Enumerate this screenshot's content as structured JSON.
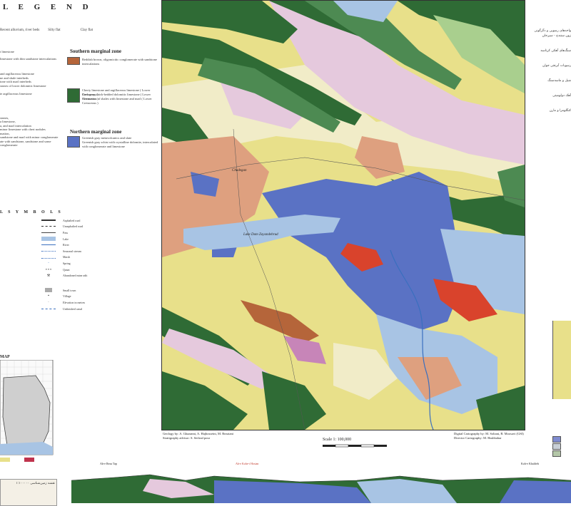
{
  "legend": {
    "title": "L E G E N D",
    "top_items": [
      "Recent alluvium, river beds",
      "Silty flat",
      "Clay flat"
    ],
    "left_fragments": [
      "t limestone",
      "limestone with thin sandstone intercalations",
      "and argillaceous limestone",
      "ne and shale interbeds",
      "tone with marl interbeds",
      "stones of lower dolomitic limestone",
      "te argillaceous limestone",
      "stones,",
      "a limestone,",
      "a, and marl intercalation",
      "minor limestone with chert nodules",
      "mation,",
      "sandstone and marl with minor conglomerate",
      "ate with sandstone, sandstone and some conglomerate"
    ],
    "southern_zone_title": "Southern marginal zone",
    "southern_entries": [
      "Reddish brown, oligomicitic conglomerate with sandstone intercalations",
      "Cherty limestone and argillaceous limestone ( Lower Cretaceous )",
      "Dark gray, thick-bedded dolomitic limestone ( Lower Cretaceous )",
      "Alternation of shales with limestone and marl ( Lower Cretaceous )"
    ],
    "northern_zone_title": "Northern marginal zone",
    "northern_entries": [
      "Greenish gray metavolcanics and slate",
      "Greenish gray schist with crystalline dolomite, intercalated with conglomerate and limestone"
    ],
    "colors": {
      "red_brown": "#b5653a",
      "dark_green": "#2f6b35",
      "mid_green": "#4d8a52",
      "blue_violet": "#5a72c4",
      "light_blue": "#a8c4e4"
    }
  },
  "symbols": {
    "title": "L   S Y M B O L S",
    "items": [
      "Asphalted road",
      "Unasphalted road",
      "Pass",
      "Lake",
      "River",
      "Seasonal stream",
      "Marsh",
      "Spring",
      "Qanat",
      "Abandoned mine adit",
      "Small town",
      "Village",
      "Elevation in metres",
      "Unfinished canal"
    ]
  },
  "index_map": {
    "title": "MAP"
  },
  "map": {
    "lake_label": "Lake Dam Zayandehrud",
    "town_label": "Chadegan",
    "credits_left": [
      "Geology by: A. Ghazanni, A. Hajhosseini, M. Rezaiani",
      "Stratigraphy advisor: S. Seifrad pour"
    ],
    "credits_right": [
      "Digital Cartography by: M. Soltani, B. Moosavi (GSI)",
      "Director Cartography: M. Hashbahar"
    ],
    "scale_text": "Scale 1: 100,000",
    "colors": {
      "yellow": "#e8e08a",
      "dark_green": "#2f6b35",
      "light_green": "#a9cf8e",
      "pink": "#e5c9dd",
      "salmon": "#dea07f",
      "blue": "#5a72c4",
      "light_blue": "#a8c4e4",
      "red": "#d9432c",
      "cream": "#f1ecc8"
    }
  },
  "cross_section": {
    "labels": [
      "Ab-e Reza Tap",
      "Ab-e Kohe-i Hosian",
      "Koh-e Khalifeh"
    ]
  },
  "persian_text": {
    "lines": [
      "نقشه زمین‌شناسی ۱:۱۰۰۰۰۰",
      "واحدهای رسوبی و دگرگونی",
      "زون سنندج - سیرجان",
      "سنگ‌های آهکی کرتاسه",
      "رسوبات آبرفتی جوان",
      "شیل و ماسه‌سنگ",
      "آهک دولومیتی",
      "کنگلومرا و مارن"
    ]
  }
}
